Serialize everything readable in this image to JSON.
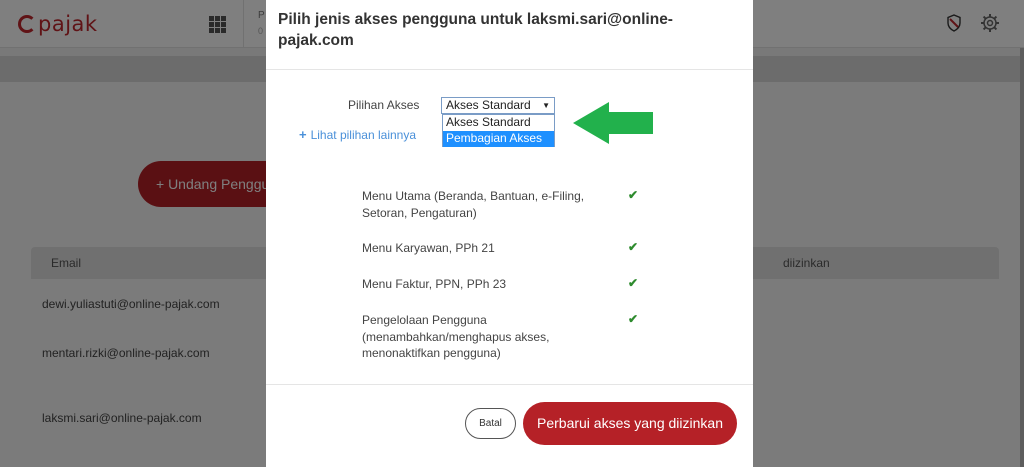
{
  "app": {
    "logo_text": "pajak",
    "top_trunc": "P",
    "top_trunc2": "0"
  },
  "page": {
    "invite_label": "+ Undang Pengguna",
    "table": {
      "col_email": "Email",
      "col_right_trunc": "diizinkan",
      "rows": [
        "dewi.yuliastuti@online-pajak.com",
        "mentari.rizki@online-pajak.com",
        "laksmi.sari@online-pajak.com"
      ]
    }
  },
  "modal": {
    "title": "Pilih jenis akses pengguna untuk laksmi.sari@online-pajak.com",
    "access_label": "Pilihan Akses",
    "select_value": "Akses Standard",
    "options": [
      "Akses Standard",
      "Pembagian Akses"
    ],
    "highlighted_option": "Pembagian Akses",
    "more_link": "Lihat pilihan lainnya",
    "permissions": [
      "Menu Utama (Beranda, Bantuan, e-Filing, Setoran, Pengaturan)",
      "Menu Karyawan, PPh 21",
      "Menu Faktur, PPN, PPh 23",
      "Pengelolaan Pengguna (menambahkan/menghapus akses, menonaktifkan pengguna)"
    ],
    "cancel_label": "Batal",
    "update_label": "Perbarui akses yang diizinkan"
  },
  "colors": {
    "brand_red": "#b52127",
    "check_green": "#2e8b2e",
    "annotation_arrow": "#22b14c",
    "option_highlight": "#1e90ff"
  },
  "icons": [
    "grid-icon",
    "shield-icon",
    "gear-icon",
    "plus-icon",
    "check-icon",
    "dropdown-arrow-icon",
    "annotation-arrow-icon"
  ]
}
